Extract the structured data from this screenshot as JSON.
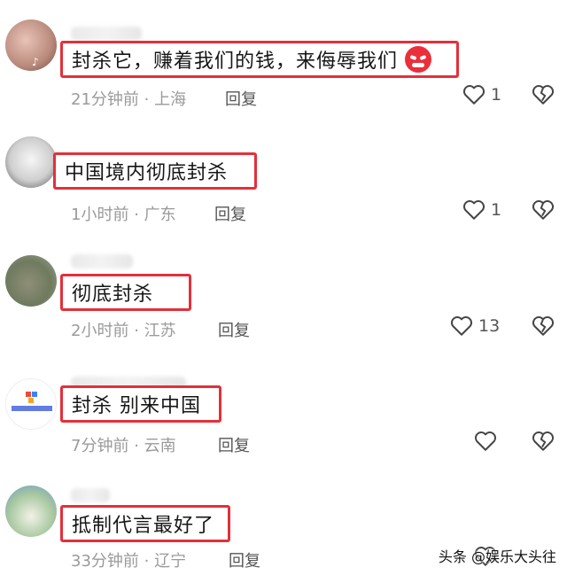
{
  "comments": [
    {
      "text": "封杀它，赚着我们的钱，来侮辱我们",
      "emoji": "angry-face-icon",
      "time": "21分钟前",
      "location": "上海",
      "reply": "回复",
      "likes": "1"
    },
    {
      "text": "中国境内彻底封杀",
      "time": "1小时前",
      "location": "广东",
      "reply": "回复",
      "likes": "1"
    },
    {
      "text": "彻底封杀",
      "time": "2小时前",
      "location": "江苏",
      "reply": "回复",
      "likes": "13"
    },
    {
      "text": "封杀 别来中国",
      "time": "7分钟前",
      "location": "云南",
      "reply": "回复",
      "likes": ""
    },
    {
      "text": "抵制代言最好了",
      "time": "33分钟前",
      "location": "辽宁",
      "reply": "回复",
      "likes": ""
    }
  ],
  "meta_separator": "·",
  "watermark": "头条 @娱乐大头往",
  "colors": {
    "highlight_border": "#e3303a",
    "meta_text": "#9a9a9a"
  }
}
